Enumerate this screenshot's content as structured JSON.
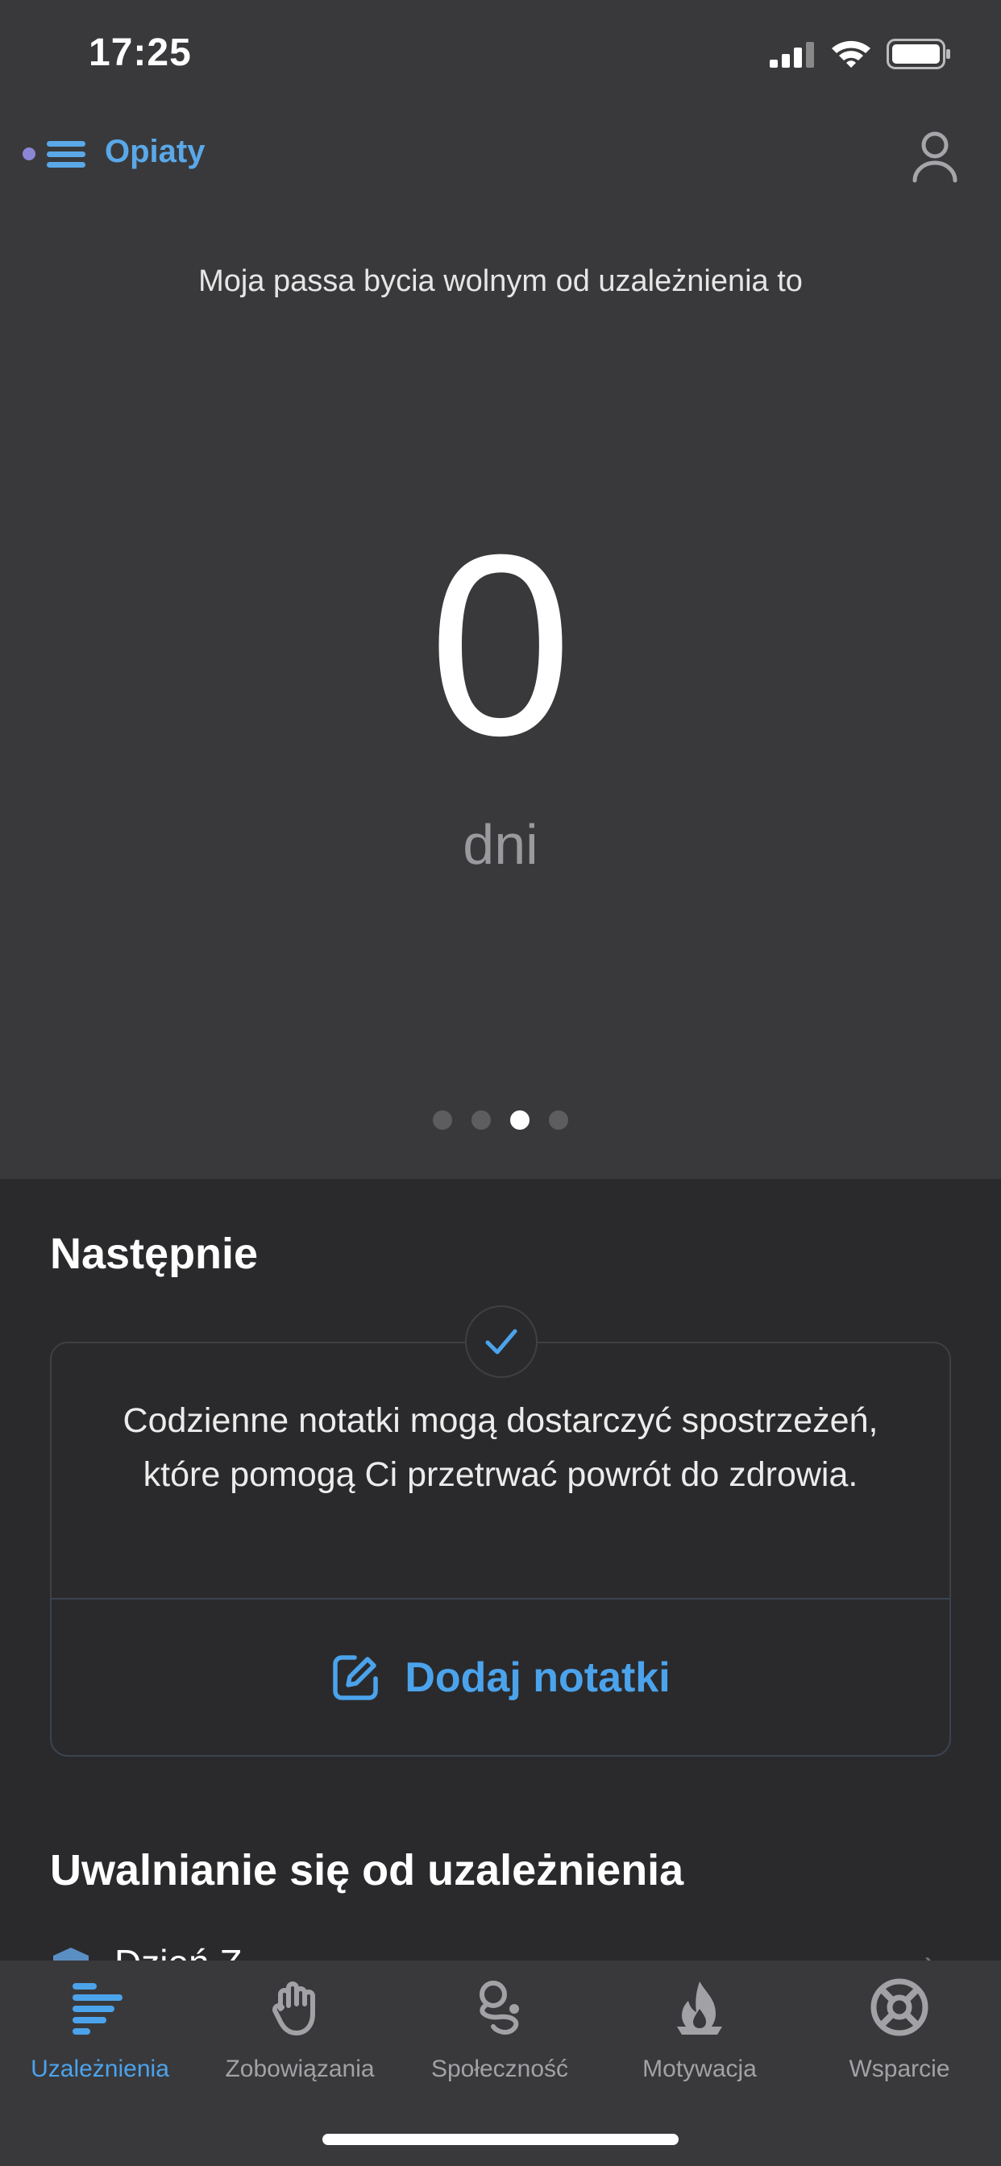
{
  "status_bar": {
    "time": "17:25"
  },
  "nav": {
    "title": "Opiaty",
    "menu_icon": "menu-icon",
    "profile_icon": "person-icon",
    "dot_color": "#8c86d6",
    "accent": "#5aa8e8"
  },
  "streak": {
    "caption": "Moja passa bycia wolnym od uzależnienia to",
    "value": "0",
    "unit": "dni",
    "pages": 4,
    "active_page": 3
  },
  "next": {
    "title": "Następnie",
    "card_text": "Codzienne notatki mogą dostarczyć spostrzeżeń, które pomogą Ci przetrwać powrót do zdrowia.",
    "action_label": "Dodaj notatki",
    "action_icon": "edit-note-icon"
  },
  "recovery": {
    "title": "Uwalnianie się od uzależnienia",
    "first_item": "Dzień Z..."
  },
  "tabs": [
    {
      "label": "Uzależnienia",
      "icon": "addictions-icon",
      "active": true
    },
    {
      "label": "Zobowiązania",
      "icon": "hand-icon",
      "active": false
    },
    {
      "label": "Społeczność",
      "icon": "community-icon",
      "active": false
    },
    {
      "label": "Motywacja",
      "icon": "flame-icon",
      "active": false
    },
    {
      "label": "Wsparcie",
      "icon": "lifebuoy-icon",
      "active": false
    }
  ],
  "colors": {
    "accent": "#4ba3ec",
    "background": "#2a2a2c",
    "header_bg": "#39393b"
  }
}
